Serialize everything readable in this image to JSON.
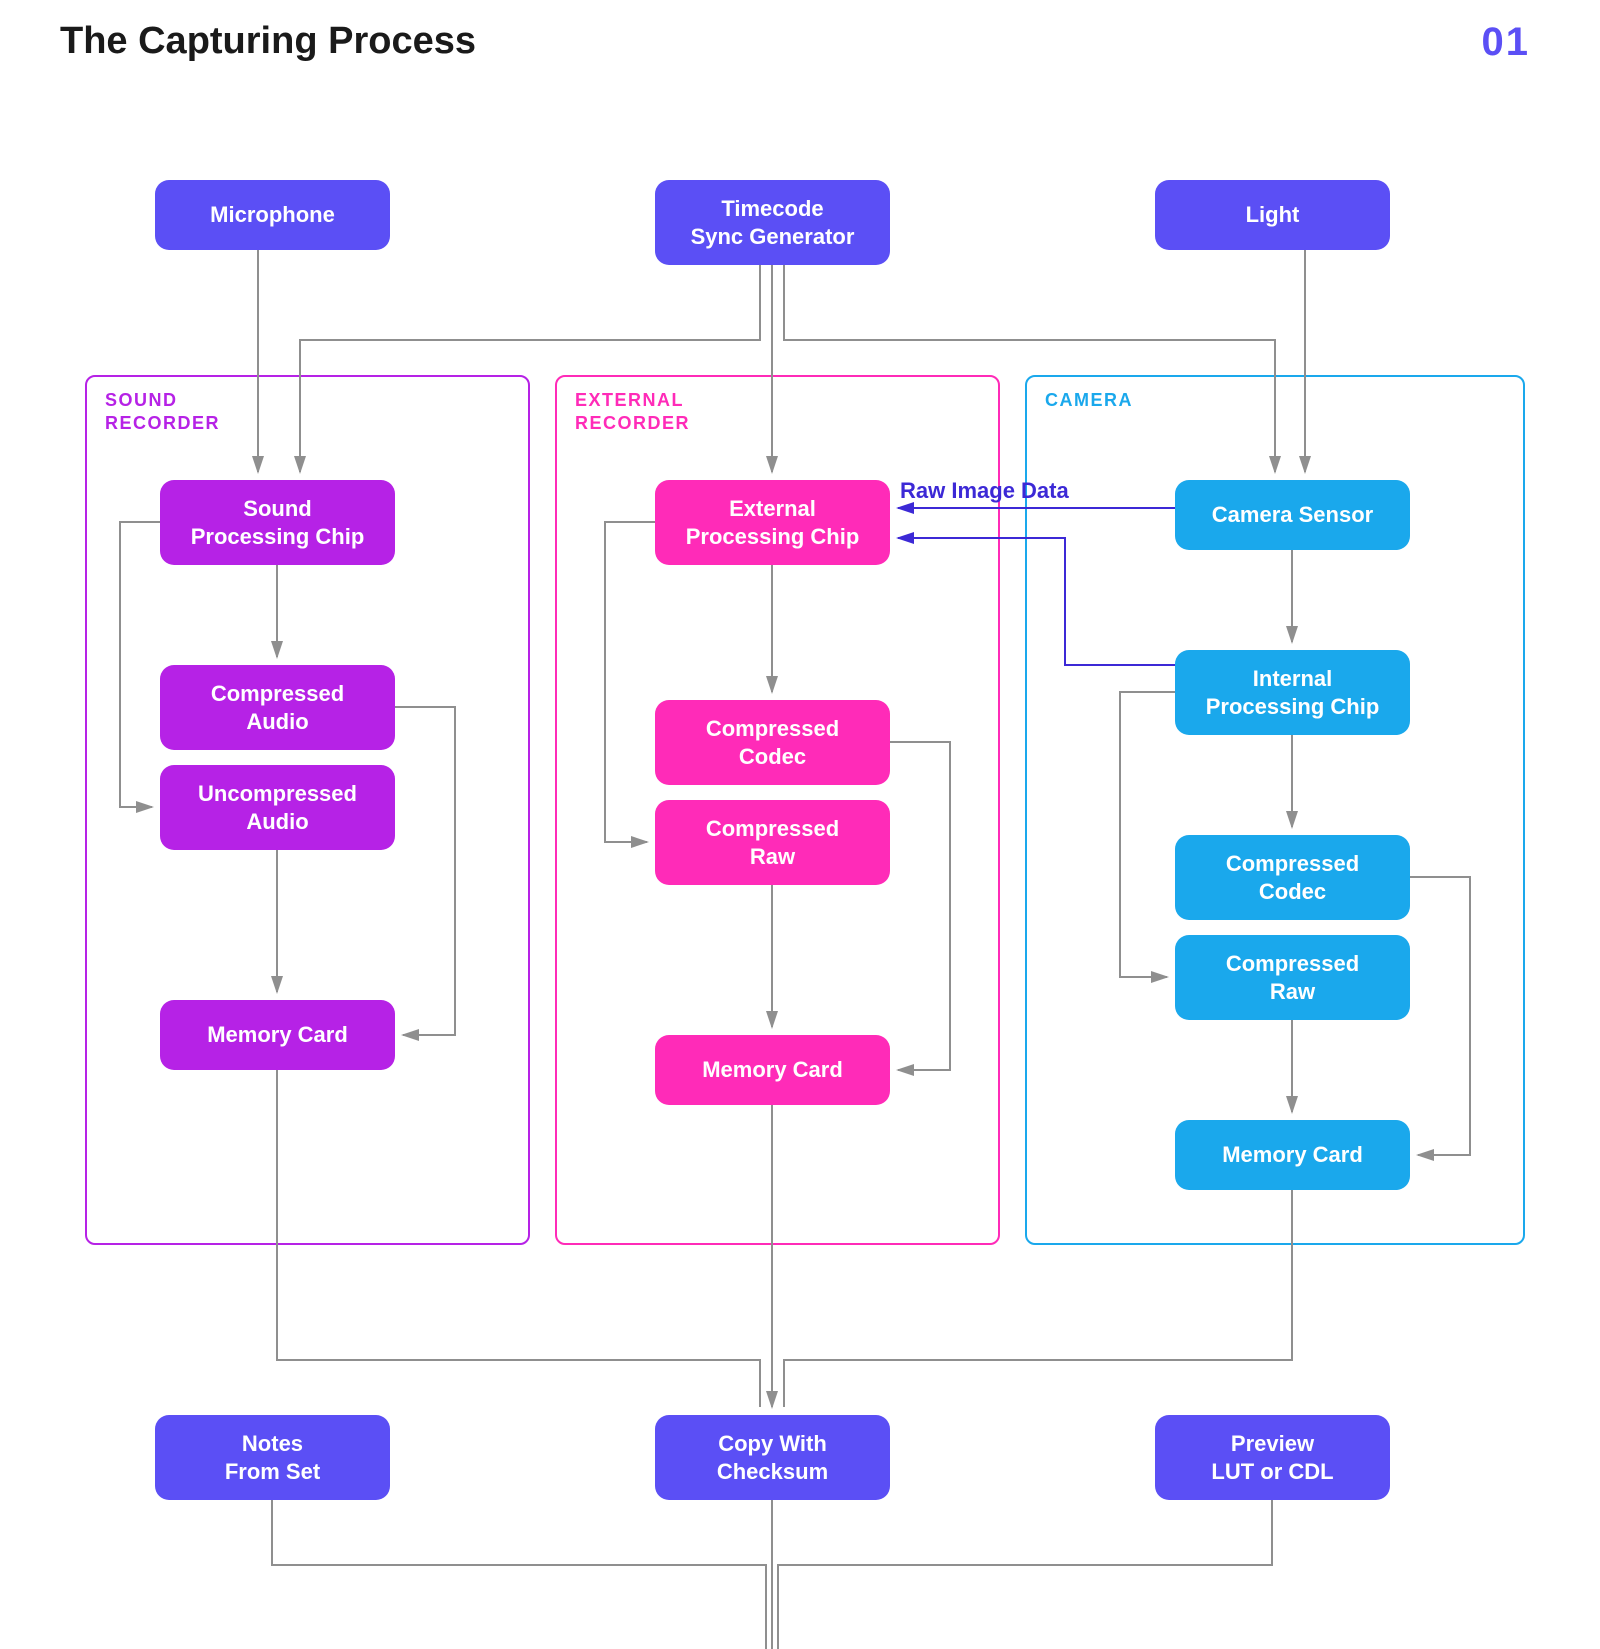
{
  "title": "The Capturing Process",
  "page_number": "01",
  "top_inputs": {
    "microphone": "Microphone",
    "timecode": "Timecode\nSync Generator",
    "light": "Light"
  },
  "groups": {
    "sound_recorder": {
      "label": "SOUND\nRECORDER",
      "nodes": {
        "sound_chip": "Sound\nProcessing Chip",
        "compressed_audio": "Compressed\nAudio",
        "uncompressed_audio": "Uncompressed\nAudio",
        "memory_card": "Memory Card"
      }
    },
    "external_recorder": {
      "label": "EXTERNAL\nRECORDER",
      "nodes": {
        "ext_chip": "External\nProcessing Chip",
        "compressed_codec": "Compressed\nCodec",
        "compressed_raw": "Compressed\nRaw",
        "memory_card": "Memory Card"
      }
    },
    "camera": {
      "label": "CAMERA",
      "nodes": {
        "camera_sensor": "Camera Sensor",
        "internal_chip": "Internal\nProcessing Chip",
        "compressed_codec": "Compressed\nCodec",
        "compressed_raw": "Compressed\nRaw",
        "memory_card": "Memory Card"
      }
    }
  },
  "raw_image_label": "Raw Image Data",
  "bottom_outputs": {
    "notes": "Notes\nFrom Set",
    "copy": "Copy With\nChecksum",
    "preview": "Preview\nLUT or CDL"
  },
  "colors": {
    "indigo": "#5b4ff5",
    "purple": "#b622e6",
    "magenta": "#ff2bb8",
    "cyan": "#1aa8ec",
    "connector_gray": "#8f8f8f",
    "connector_blue": "#3c29d6"
  }
}
